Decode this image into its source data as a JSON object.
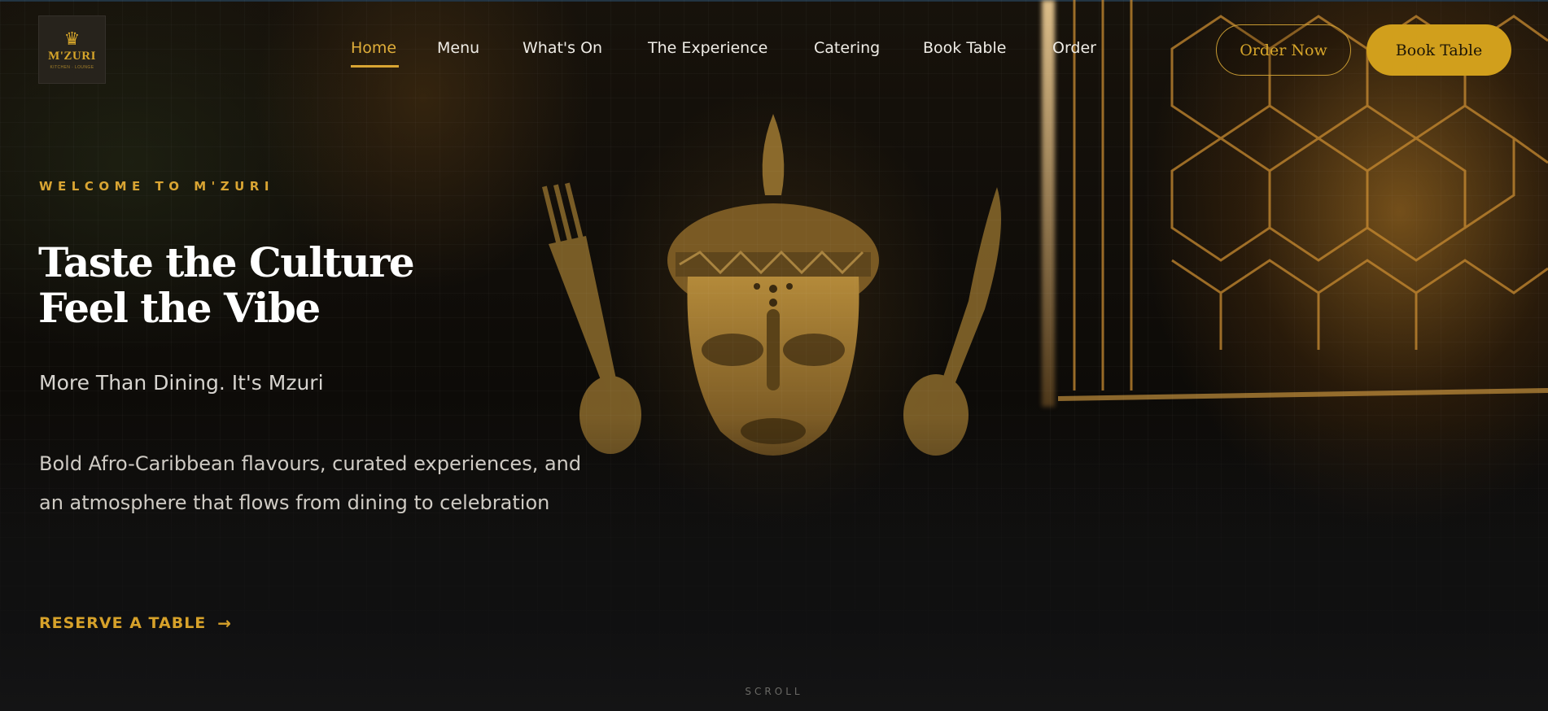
{
  "header": {
    "logo": {
      "name": "M'ZURI",
      "tagline": "KITCHEN · LOUNGE"
    },
    "nav": [
      {
        "label": "Home",
        "active": true
      },
      {
        "label": "Menu"
      },
      {
        "label": "What's On"
      },
      {
        "label": "The Experience"
      },
      {
        "label": "Catering"
      },
      {
        "label": "Book Table"
      },
      {
        "label": "Order"
      }
    ],
    "order_now_label": "Order Now",
    "book_table_label": "Book Table"
  },
  "hero": {
    "eyebrow": "WELCOME TO M'ZURI",
    "headline_line1": "Taste the Culture",
    "headline_line2": "Feel the Vibe",
    "tagline": "More Than Dining. It's Mzuri",
    "description": "Bold Afro-Caribbean flavours, curated experiences, and an atmosphere that flows from dining to celebration",
    "cta_label": "RESERVE A TABLE",
    "cta_arrow_icon": "arrow-right-icon",
    "scroll_label": "SCROLL"
  },
  "colors": {
    "accent": "#d19f1c",
    "accent_text": "#d9a533",
    "background": "#0b0a08"
  }
}
